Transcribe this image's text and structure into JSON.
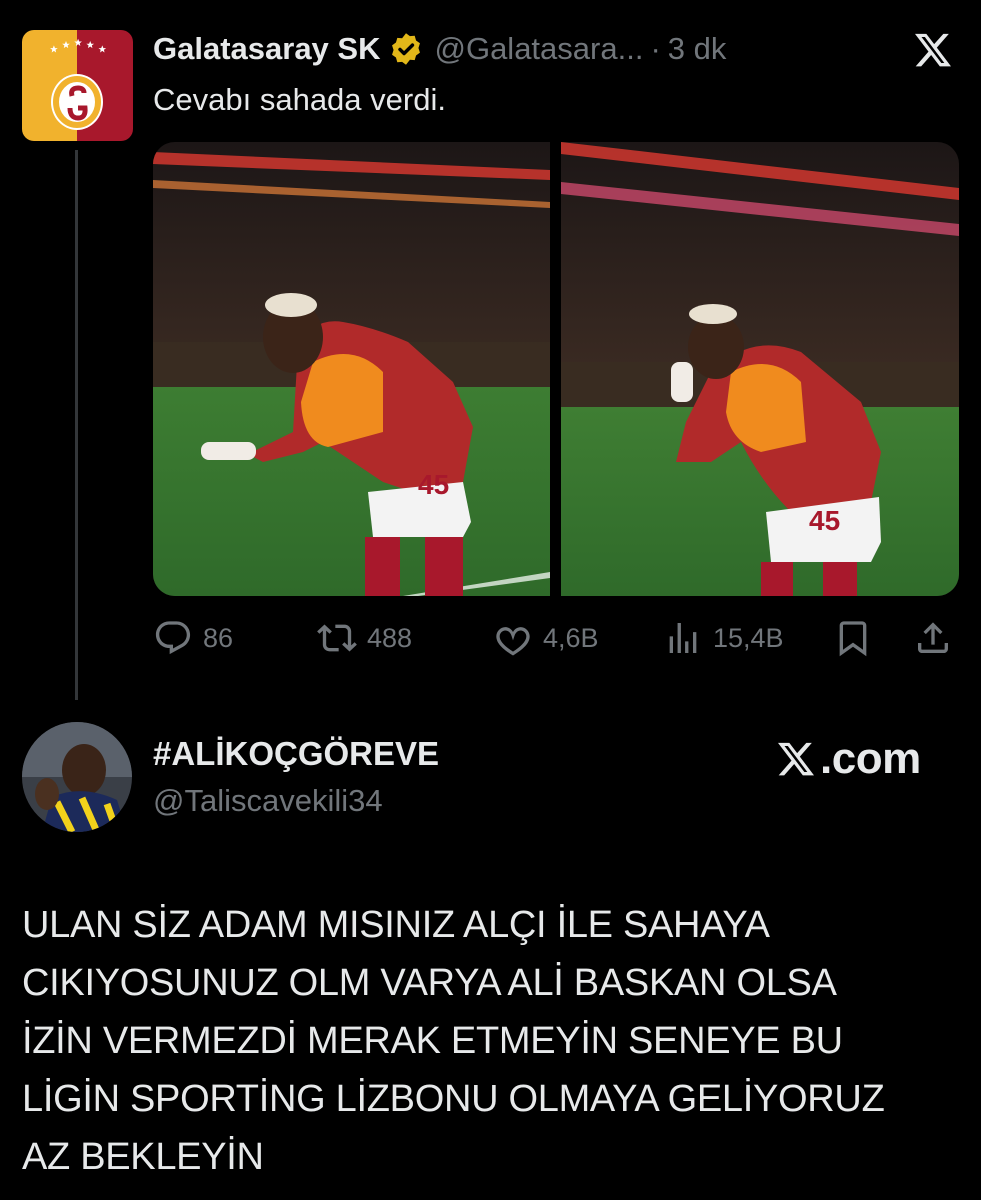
{
  "tweet": {
    "author": {
      "display_name": "Galatasaray SK",
      "handle": "@Galatasara...",
      "verified": true,
      "avatar_icon": "galatasaray-crest-icon"
    },
    "separator": "·",
    "time": "3 dk",
    "text": "Cevabı sahada verdi.",
    "media": [
      {
        "icon": "photo-player-pointing"
      },
      {
        "icon": "photo-player-hands-to-face"
      }
    ],
    "jersey_number": "45",
    "actions": {
      "replies": "86",
      "reposts": "488",
      "likes": "4,6B",
      "views": "15,4B"
    }
  },
  "reply": {
    "author": {
      "display_name": "#ALİKOÇGÖREVE",
      "handle": "@Taliscavekili34"
    },
    "brand_text": ".com",
    "body_lines": [
      "ULAN SİZ ADAM MISINIZ ALÇI İLE SAHAYA",
      "CIKIYOSUNUZ OLM VARYA ALİ BASKAN OLSA",
      "İZİN VERMEZDİ MERAK ETMEYİN SENEYE BU",
      "LİGİN SPORTİNG LİZBONU OLMAYA GELİYORUZ",
      "AZ BEKLEYİN"
    ]
  },
  "colors": {
    "background": "#000000",
    "text": "#e7e9ea",
    "muted": "#71767b",
    "gs_yellow": "#f1b22d",
    "gs_red": "#a8182c",
    "verified_gold": "#e2b719"
  }
}
